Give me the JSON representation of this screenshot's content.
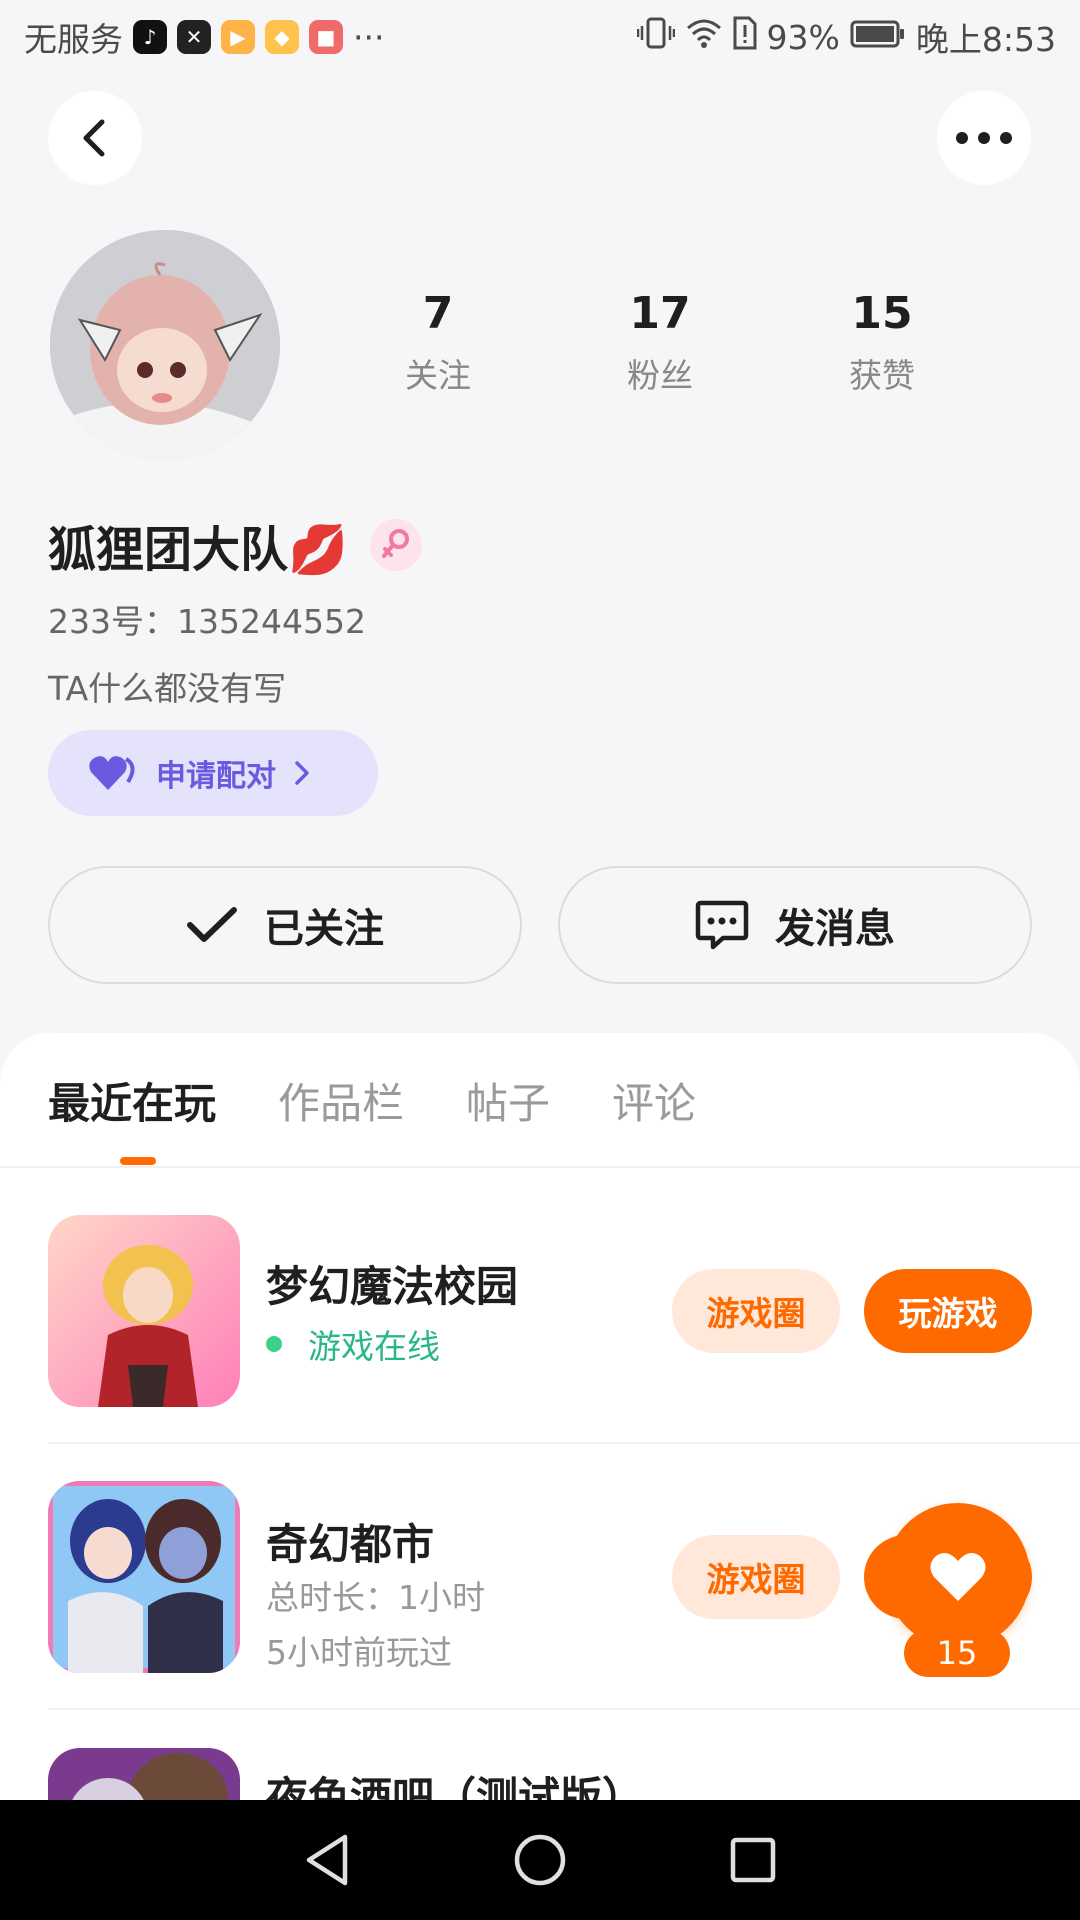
{
  "status_bar": {
    "carrier": "无服务",
    "more": "···",
    "battery": "93%",
    "time": "晚上8:53"
  },
  "profile": {
    "name": "狐狸团大队💋",
    "id_line": "233号：135244552",
    "bio": "TA什么都没有写",
    "stats": [
      {
        "num": "7",
        "label": "关注"
      },
      {
        "num": "17",
        "label": "粉丝"
      },
      {
        "num": "15",
        "label": "获赞"
      }
    ],
    "pair_label": "申请配对",
    "followed_label": "已关注",
    "message_label": "发消息"
  },
  "tabs": [
    "最近在玩",
    "作品栏",
    "帖子",
    "评论"
  ],
  "games": [
    {
      "title": "梦幻魔法校园",
      "status": "游戏在线",
      "circle_label": "游戏圈",
      "play_label": "玩游戏"
    },
    {
      "title": "奇幻都市",
      "duration": "总时长：1小时",
      "last_played": "5小时前玩过",
      "circle_label": "游戏圈"
    },
    {
      "title": "夜色酒吧（测试版）"
    }
  ],
  "like": {
    "count": "15"
  },
  "colors": {
    "accent": "#ff6a00",
    "pair": "#6a5ae0",
    "online": "#2ab58a"
  }
}
